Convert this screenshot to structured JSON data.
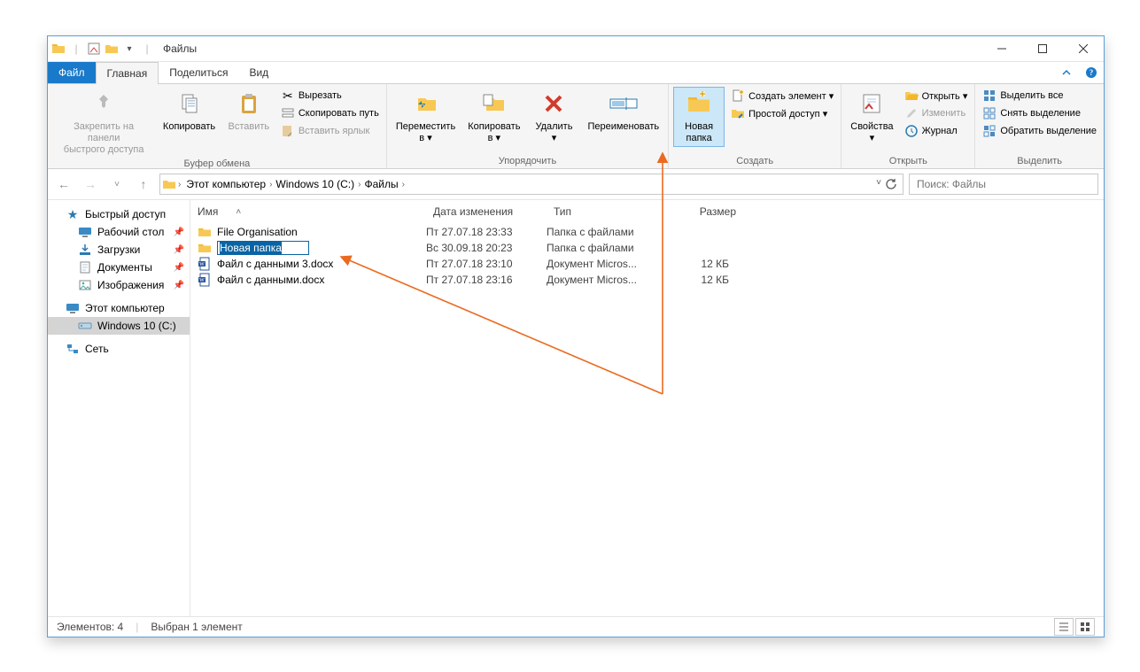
{
  "window": {
    "title": "Файлы"
  },
  "tabs": {
    "file": "Файл",
    "home": "Главная",
    "share": "Поделиться",
    "view": "Вид"
  },
  "ribbon": {
    "clipboard": {
      "pin": "Закрепить на панели\nбыстрого доступа",
      "copy": "Копировать",
      "paste": "Вставить",
      "cut": "Вырезать",
      "copy_path": "Скопировать путь",
      "paste_shortcut": "Вставить ярлык",
      "group": "Буфер обмена"
    },
    "organize": {
      "move_to": "Переместить\nв ▾",
      "copy_to": "Копировать\nв ▾",
      "delete": "Удалить\n▾",
      "rename": "Переименовать",
      "group": "Упорядочить"
    },
    "new": {
      "new_folder": "Новая\nпапка",
      "new_item": "Создать элемент ▾",
      "easy_access": "Простой доступ ▾",
      "group": "Создать"
    },
    "open": {
      "properties": "Свойства\n▾",
      "open": "Открыть ▾",
      "edit": "Изменить",
      "history": "Журнал",
      "group": "Открыть"
    },
    "select": {
      "select_all": "Выделить все",
      "select_none": "Снять выделение",
      "invert": "Обратить выделение",
      "group": "Выделить"
    }
  },
  "breadcrumbs": [
    "Этот компьютер",
    "Windows 10 (C:)",
    "Файлы"
  ],
  "search_placeholder": "Поиск: Файлы",
  "columns": {
    "name": "Имя",
    "date": "Дата изменения",
    "type": "Тип",
    "size": "Размер"
  },
  "sidebar": {
    "quick_access": "Быстрый доступ",
    "desktop": "Рабочий стол",
    "downloads": "Загрузки",
    "documents": "Документы",
    "pictures": "Изображения",
    "this_pc": "Этот компьютер",
    "drive_c": "Windows 10 (C:)",
    "network": "Сеть"
  },
  "files": [
    {
      "name": "File Organisation",
      "date": "Пт 27.07.18 23:33",
      "type": "Папка с файлами",
      "size": "",
      "kind": "folder"
    },
    {
      "name": "Новая папка",
      "date": "Вс 30.09.18 20:23",
      "type": "Папка с файлами",
      "size": "",
      "kind": "folder-editing"
    },
    {
      "name": "Файл с данными 3.docx",
      "date": "Пт 27.07.18 23:10",
      "type": "Документ Micros...",
      "size": "12 КБ",
      "kind": "docx"
    },
    {
      "name": "Файл с данными.docx",
      "date": "Пт 27.07.18 23:16",
      "type": "Документ Micros...",
      "size": "12 КБ",
      "kind": "docx"
    }
  ],
  "status": {
    "count": "Элементов: 4",
    "selected": "Выбран 1 элемент"
  }
}
